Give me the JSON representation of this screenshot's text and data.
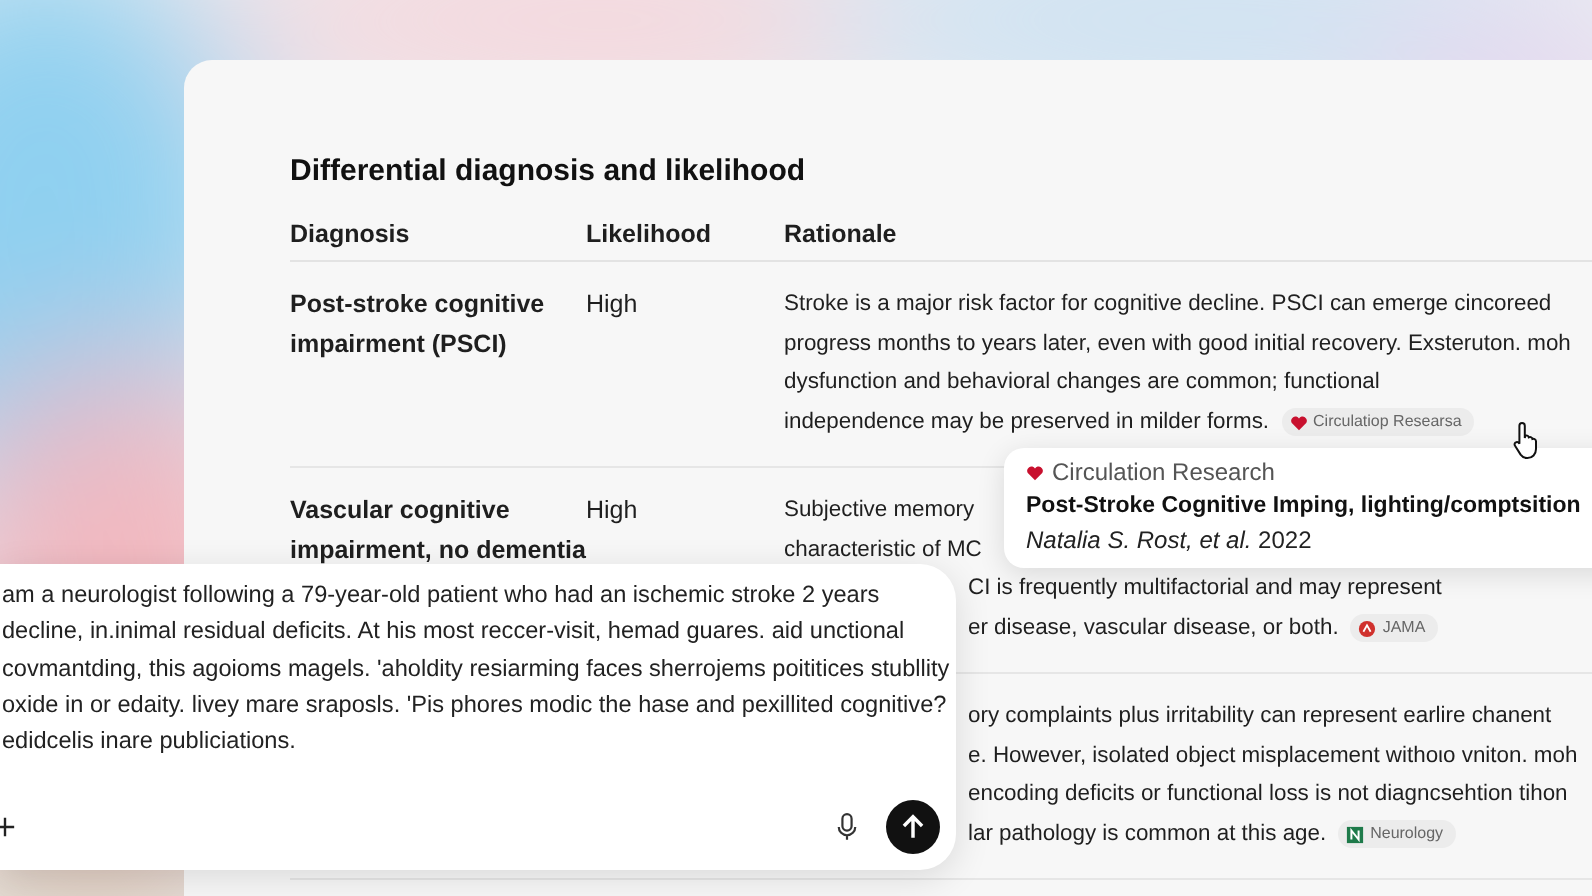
{
  "section": {
    "title": "Differential diagnosis and likelihood",
    "columns": [
      "Diagnosis",
      "Likelihood",
      "Rationale"
    ],
    "rows": [
      {
        "diagnosis_lines": [
          "Post-stroke cognitive",
          "impairment (PSCI)"
        ],
        "likelihood": "High",
        "rationale_lines": [
          "Stroke is a major risk factor for cognitive decline. PSCI can emerge cincoreed",
          "progress months to years later, even with good initial recovery. Exsteruton. moh",
          "dysfunction and behavioral changes are common; functional",
          "independence may be preserved in milder forms."
        ],
        "citation": {
          "kind": "heart",
          "source": "Circulatiop Researsa"
        }
      },
      {
        "diagnosis_lines": [
          "Vascular cognitive",
          "impairment, no dementia"
        ],
        "likelihood": "High",
        "rationale_lines": [
          "Subjective memory",
          "characteristic of MC"
        ],
        "rationale_cut_lines": [
          "CI is frequently multifactorial and may represent",
          "er disease, vascular disease, or both."
        ],
        "citation": {
          "kind": "jama",
          "source": "JAMA"
        }
      },
      {
        "rationale_cut_lines": [
          "ory complaints plus irritability can represent earlire chanent",
          "e. However, isolated object misplacement withoιο vniton. moh",
          "encoding deficits or functional loss is not diagncsehtion tihon",
          "lar pathology is common at this age."
        ],
        "citation": {
          "kind": "neurology",
          "source": "Neurology"
        }
      }
    ]
  },
  "source_popup": {
    "source": "Circulation Research",
    "title": "Post-Stroke Cognitive Imping, lighting/comptsition",
    "byline": "*Natalia S. Rost, et al.* 2022"
  },
  "composer": {
    "value_lines": [
      "am a neurologist following a 79-year-old patient who had an ischemic stroke 2 years",
      "decline, in.inimal residual deficits. At his most reccer-visit, hemad guares. aid unctional",
      "covmantding, this agoioms magels.  'aholdity resiarming faces sherrojems poititices stubllity",
      "oxide in or edaity. livey mare sraposls. 'Pis phores modic the hase and pexillited cognitive?",
      "edidcelis inare publiciations."
    ]
  }
}
